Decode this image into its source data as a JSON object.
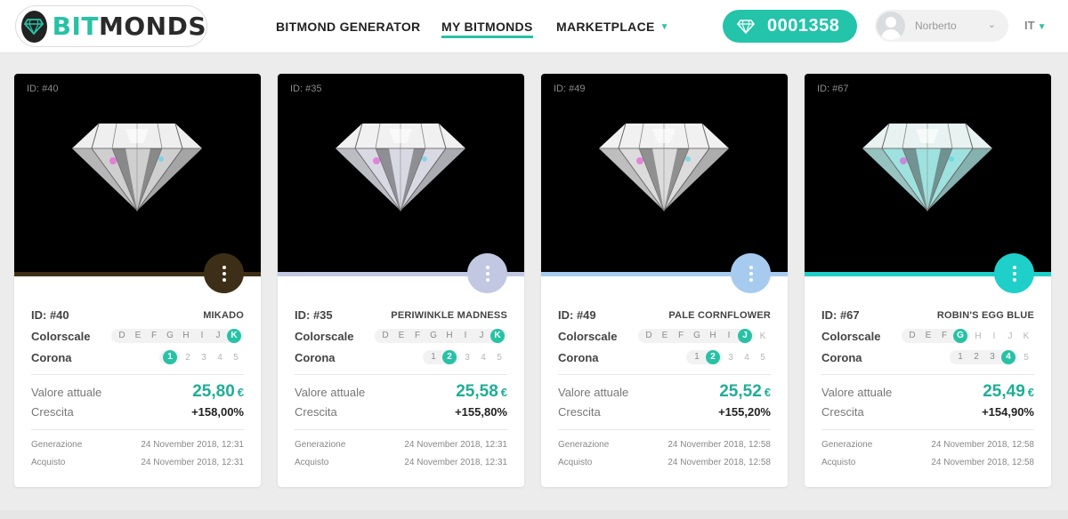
{
  "brand": {
    "name_part1": "BIT",
    "name_part2": "MONDS"
  },
  "nav": {
    "generator": "BITMOND GENERATOR",
    "my": "MY BITMONDS",
    "marketplace": "MARKETPLACE"
  },
  "balance": "0001358",
  "user": {
    "name": "Norberto"
  },
  "lang": "IT",
  "labels": {
    "colorscale": "Colorscale",
    "corona": "Corona",
    "current_value": "Valore attuale",
    "growth": "Crescita",
    "generation": "Generazione",
    "purchase": "Acquisto",
    "currency": "€"
  },
  "colorscale_letters": [
    "D",
    "E",
    "F",
    "G",
    "H",
    "I",
    "J",
    "K"
  ],
  "corona_numbers": [
    "1",
    "2",
    "3",
    "4",
    "5"
  ],
  "cards": [
    {
      "overlay_id": "ID: #40",
      "id": "ID: #40",
      "name": "MIKADO",
      "accent": "#3d2f17",
      "gem_tint": "#cfcfcf",
      "colorscale": "K",
      "corona": "1",
      "value": "25,80",
      "growth": "+158,00%",
      "generated": "24 November 2018, 12:31",
      "purchased": "24 November 2018, 12:31"
    },
    {
      "overlay_id": "ID: #35",
      "id": "ID: #35",
      "name": "PERIWINKLE MADNESS",
      "accent": "#c2c8e2",
      "gem_tint": "#d9d9e4",
      "colorscale": "K",
      "corona": "2",
      "value": "25,58",
      "growth": "+155,80%",
      "generated": "24 November 2018, 12:31",
      "purchased": "24 November 2018, 12:31"
    },
    {
      "overlay_id": "ID: #49",
      "id": "ID: #49",
      "name": "PALE CORNFLOWER",
      "accent": "#a7cbef",
      "gem_tint": "#dcdcdc",
      "colorscale": "J",
      "corona": "2",
      "value": "25,52",
      "growth": "+155,20%",
      "generated": "24 November 2018, 12:58",
      "purchased": "24 November 2018, 12:58"
    },
    {
      "overlay_id": "ID: #67",
      "id": "ID: #67",
      "name": "ROBIN'S EGG BLUE",
      "accent": "#1fcfc9",
      "gem_tint": "#9ee2df",
      "colorscale": "G",
      "corona": "4",
      "value": "25,49",
      "growth": "+154,90%",
      "generated": "24 November 2018, 12:58",
      "purchased": "24 November 2018, 12:58"
    }
  ]
}
